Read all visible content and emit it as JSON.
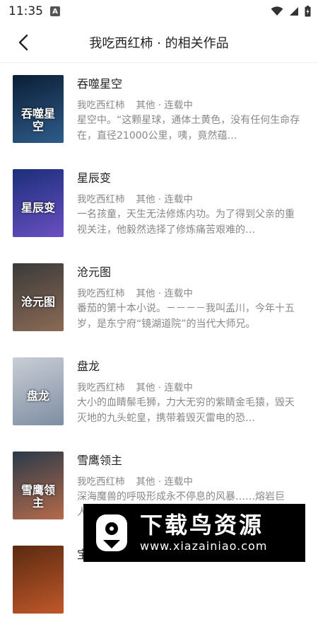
{
  "status_bar": {
    "time": "11:35",
    "notification_badge": "A",
    "icons": [
      "wifi-icon",
      "signal-icon",
      "battery-icon"
    ]
  },
  "header": {
    "title": "我吃西红柿 · 的相关作品",
    "back_icon": "back-arrow-icon"
  },
  "books": [
    {
      "title": "吞噬星空",
      "author": "我吃西红柿",
      "category": "其他 · 连载中",
      "description": "星空中。“这颗星球，通体土黄色，没有任何生命存在，直径21000公里，咦，竟然蕴…",
      "cover_text": "吞噬星空",
      "cover_colors": [
        "#0b1e35",
        "#2e5c8a"
      ]
    },
    {
      "title": "星辰变",
      "author": "我吃西红柿",
      "category": "其他 · 连载中",
      "description": "一名孩童，天生无法修炼内功。为了得到父亲的重视关注，他毅然选择了修炼痛苦艰难的…",
      "cover_text": "星辰变",
      "cover_colors": [
        "#1b2f7a",
        "#6a4fc2"
      ]
    },
    {
      "title": "沧元图",
      "author": "我吃西红柿",
      "category": "其他 · 连载中",
      "description": "番茄的第十本小说。－－－－我叫孟川，今年十五岁，是东宁府“镜湖道院”的当代大师兄。",
      "cover_text": "沧元图",
      "cover_colors": [
        "#3a3a3a",
        "#8b6a55"
      ]
    },
    {
      "title": "盘龙",
      "author": "我吃西红柿",
      "category": "其他 · 连载中",
      "description": "大小的血睛鬃毛狮，力大无穷的紫睛金毛猿，毁天灭地的九头蛇皇，携带着毁灭雷电的恐…",
      "cover_text": "盘龙",
      "cover_colors": [
        "#c9ced6",
        "#7e8ea3"
      ]
    },
    {
      "title": "雪鹰领主",
      "author": "我吃西红柿",
      "category": "其他 · 连载中",
      "description": "深海魔兽的呼吸形成永不停息的风暴……熔岩巨人…",
      "cover_text": "雪鹰领主",
      "cover_colors": [
        "#2a3a4a",
        "#b56a4a"
      ]
    },
    {
      "title": "宝",
      "author": "",
      "category": "",
      "description": "",
      "cover_text": "",
      "cover_colors": [
        "#5a2a10",
        "#c0582a"
      ]
    }
  ],
  "watermark": {
    "text": "下载鸟资源",
    "url": "www.xiazainiao.com"
  }
}
